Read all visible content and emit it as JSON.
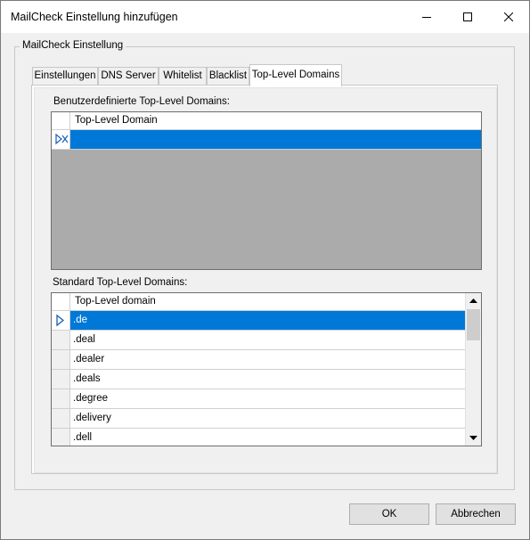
{
  "window": {
    "title": "MailCheck Einstellung hinzufügen"
  },
  "group": {
    "legend": "MailCheck Einstellung"
  },
  "tabs": [
    {
      "label": "Einstellungen"
    },
    {
      "label": "DNS Server"
    },
    {
      "label": "Whitelist"
    },
    {
      "label": "Blacklist"
    },
    {
      "label": "Top-Level Domains",
      "active": true
    }
  ],
  "custom": {
    "label": "Benutzerdefinierte Top-Level Domains:",
    "column_header": "Top-Level Domain",
    "rows": [
      ""
    ]
  },
  "standard": {
    "label": "Standard Top-Level Domains:",
    "column_header": "Top-Level domain",
    "rows": [
      ".de",
      ".deal",
      ".dealer",
      ".deals",
      ".degree",
      ".delivery",
      ".dell"
    ]
  },
  "buttons": {
    "ok": "OK",
    "cancel": "Abbrechen"
  },
  "colors": {
    "selection": "#0078d7",
    "grid_background": "#ababab"
  }
}
